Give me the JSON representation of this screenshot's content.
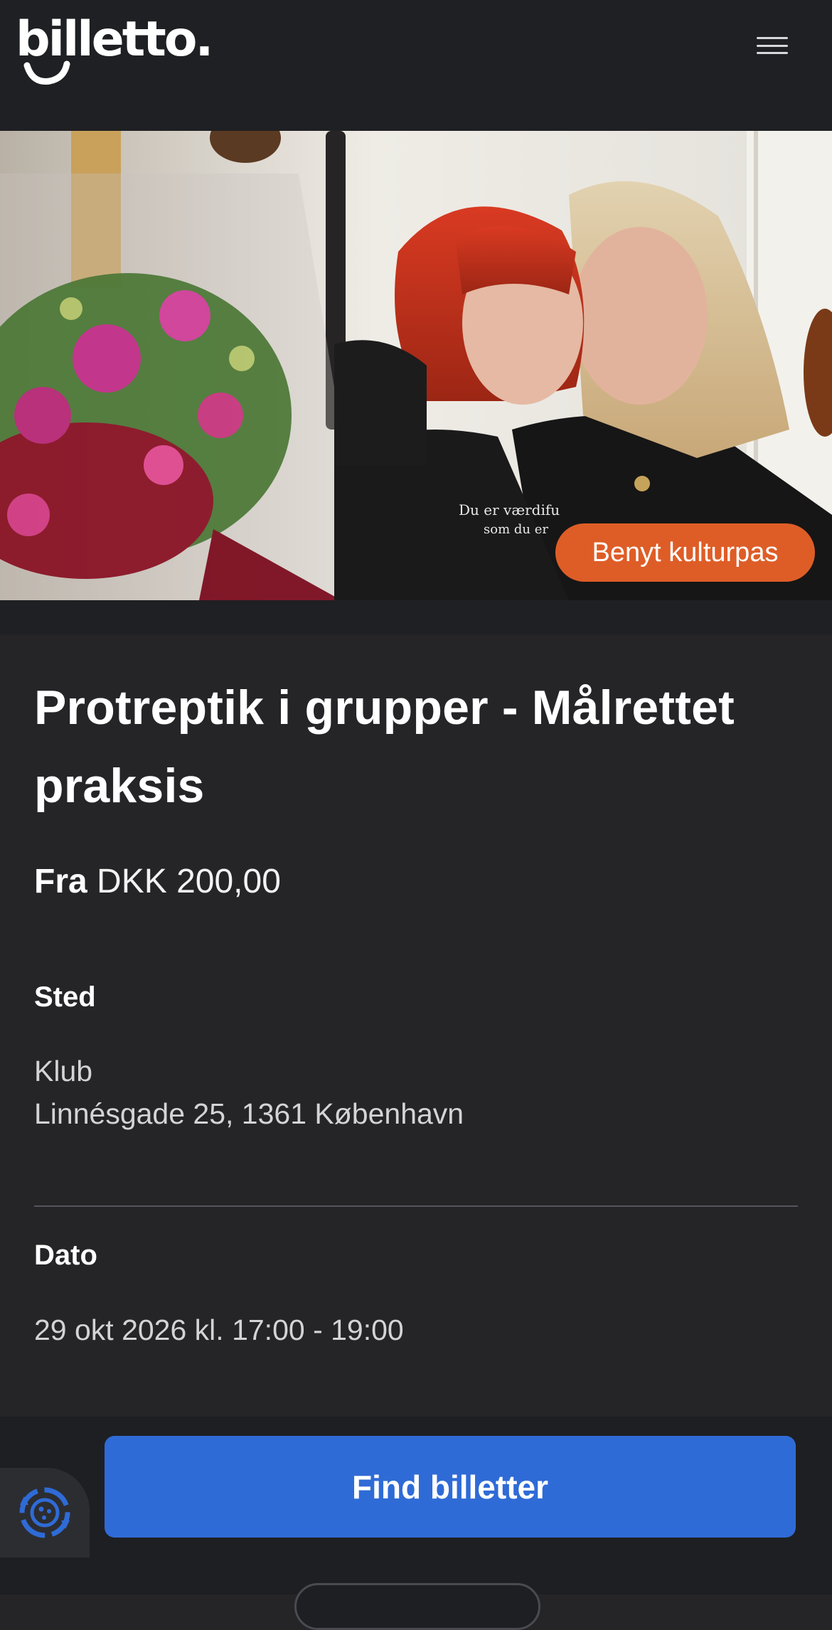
{
  "header": {
    "logo_text": "billetto.",
    "menu_icon": "hamburger-menu-icon"
  },
  "hero": {
    "badge_label": "Benyt kulturpas",
    "hoodie_text_line1": "Du er værdifu",
    "hoodie_text_line2": "som du er"
  },
  "event": {
    "title": "Protreptik i grupper - Målrettet praksis",
    "price_prefix": "Fra",
    "price_value": "DKK 200,00",
    "venue_label": "Sted",
    "venue_name": "Klub",
    "venue_address": "Linnésgade 25, 1361 København",
    "date_label": "Dato",
    "date_value": "29 okt 2026 kl. 17:00 - 19:00"
  },
  "footer": {
    "cta_label": "Find billetter",
    "cookie_icon": "cookie-settings-icon"
  },
  "colors": {
    "background": "#252528",
    "header": "#1f2023",
    "accent_orange": "#de5d27",
    "button_blue": "#2f6bd6"
  }
}
